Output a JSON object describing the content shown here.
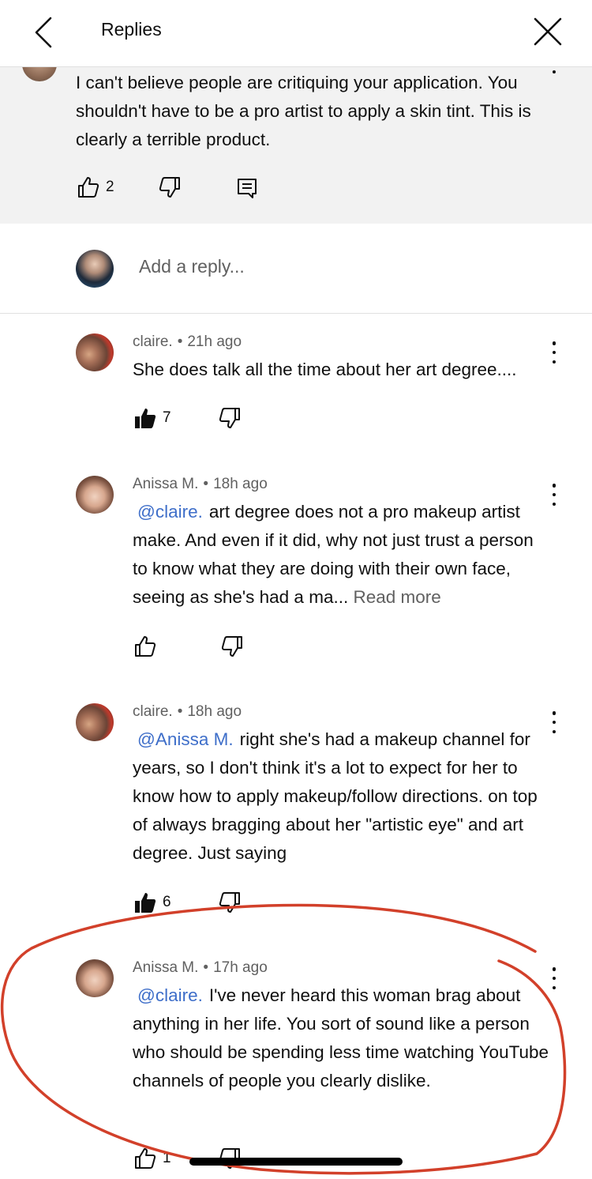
{
  "header": {
    "title": "Replies",
    "back_icon": "chevron-left-icon",
    "close_icon": "close-icon"
  },
  "original_comment": {
    "text": "I can't believe people are critiquing your application. You shouldn't have to be a pro artist to apply a skin tint. This is clearly a terrible product.",
    "like_count": "2"
  },
  "reply_box": {
    "placeholder": "Add a reply..."
  },
  "replies": [
    {
      "author": "claire.",
      "time": "21h ago",
      "mention": "",
      "text": "She does talk all the time about her art degree....",
      "read_more": "",
      "like_count": "7",
      "liked": true
    },
    {
      "author": "Anissa M.",
      "time": "18h ago",
      "mention": "@claire.",
      "text": "art degree does not a pro makeup artist make. And even if it did, why not just trust a person to know what they are doing with their own face, seeing as she's had a ma...",
      "read_more": "Read more",
      "like_count": "",
      "liked": false
    },
    {
      "author": "claire.",
      "time": "18h ago",
      "mention": "@Anissa M.",
      "text": "right she's had a makeup channel for years, so I don't think it's a lot to expect for her to know how to apply makeup/follow directions. on top of always bragging about her \"artistic eye\" and art degree. Just saying",
      "read_more": "",
      "like_count": "6",
      "liked": true
    },
    {
      "author": "Anissa M.",
      "time": "17h ago",
      "mention": "@claire.",
      "text": "I've never heard this woman brag about anything in her life. You sort of sound like a person who should be spending less time watching YouTube channels of people you clearly dislike.",
      "read_more": "",
      "like_count": "1",
      "liked": false
    }
  ],
  "colors": {
    "mention": "#3e6ec9",
    "annotation_circle": "#d2402a"
  }
}
